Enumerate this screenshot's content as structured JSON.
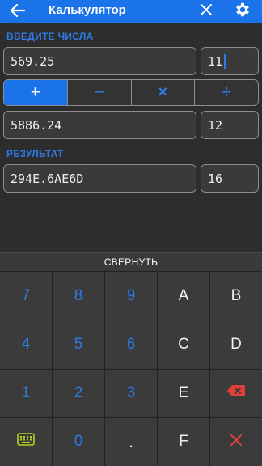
{
  "appbar": {
    "title": "Калькулятор",
    "back_icon": "arrow-back-icon",
    "close_icon": "close-icon",
    "settings_icon": "gear-icon",
    "color": "#1a73e8"
  },
  "inputs": {
    "section_label": "ВВЕДИТЕ ЧИСЛА",
    "first_value": "569.25",
    "first_base": "11",
    "second_value": "5886.24",
    "second_base": "12"
  },
  "operations": {
    "items": [
      "+",
      "−",
      "×",
      "÷"
    ],
    "selected": "+"
  },
  "result": {
    "section_label": "РЕЗУЛЬТАТ",
    "value": "294E.6AE6D",
    "base": "16"
  },
  "keyboard": {
    "collapse_label": "СВЕРНУТЬ",
    "rows": [
      [
        "7",
        "8",
        "9",
        "A",
        "B"
      ],
      [
        "4",
        "5",
        "6",
        "C",
        "D"
      ],
      [
        "1",
        "2",
        "3",
        "E",
        "⌫"
      ],
      [
        "⌨",
        "0",
        ".",
        "F",
        "✕"
      ]
    ]
  },
  "colors": {
    "accent": "#2f7be5",
    "background": "#2d2d2d",
    "delete": "#e0403a",
    "keyboard_icon": "#b6d11a"
  }
}
